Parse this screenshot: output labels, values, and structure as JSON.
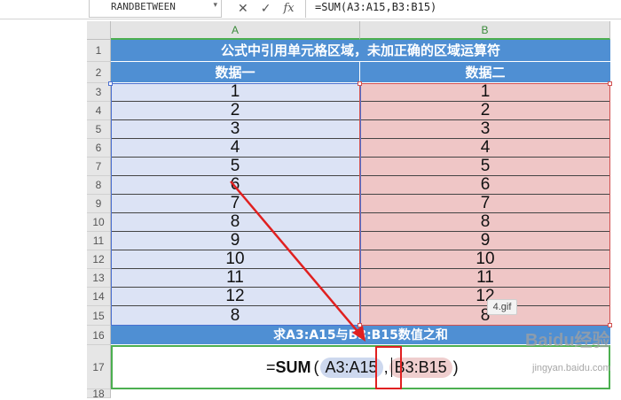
{
  "formula_bar": {
    "name_box": "RANDBETWEEN",
    "formula": "=SUM(A3:A15,B3:B15)",
    "icons": [
      "cancel-icon",
      "confirm-icon",
      "fx-icon"
    ]
  },
  "columns": [
    "A",
    "B"
  ],
  "rows": [
    "1",
    "2",
    "3",
    "4",
    "5",
    "6",
    "7",
    "8",
    "9",
    "10",
    "11",
    "12",
    "13",
    "14",
    "15",
    "16",
    "17",
    "18"
  ],
  "sheet": {
    "title": "公式中引用单元格区域，未加正确的区域运算符",
    "header_a": "数据一",
    "header_b": "数据二",
    "data_a": [
      "1",
      "2",
      "3",
      "4",
      "5",
      "6",
      "7",
      "8",
      "9",
      "10",
      "11",
      "12",
      "8"
    ],
    "data_b": [
      "1",
      "2",
      "3",
      "4",
      "5",
      "6",
      "7",
      "8",
      "9",
      "10",
      "11",
      "12",
      "8"
    ],
    "sum_label": "求A3:A15与B3:B15数值之和",
    "cell17": {
      "prefix": "=",
      "func": "SUM",
      "open": "(",
      "range_a": "A3:A15",
      "sep": ",",
      "range_b": "B3:B15",
      "close": ")"
    }
  },
  "annotation": {
    "tooltip": "4.gif",
    "watermark_url": "jingyan.baidu.com",
    "watermark_logo": "Baidu经验"
  },
  "colors": {
    "band_blue": "#4f8fd3",
    "col_a_fill": "#dce3f5",
    "col_b_fill": "#efc6c6",
    "arrow_red": "#e02020",
    "selection_green": "#4caf50"
  }
}
